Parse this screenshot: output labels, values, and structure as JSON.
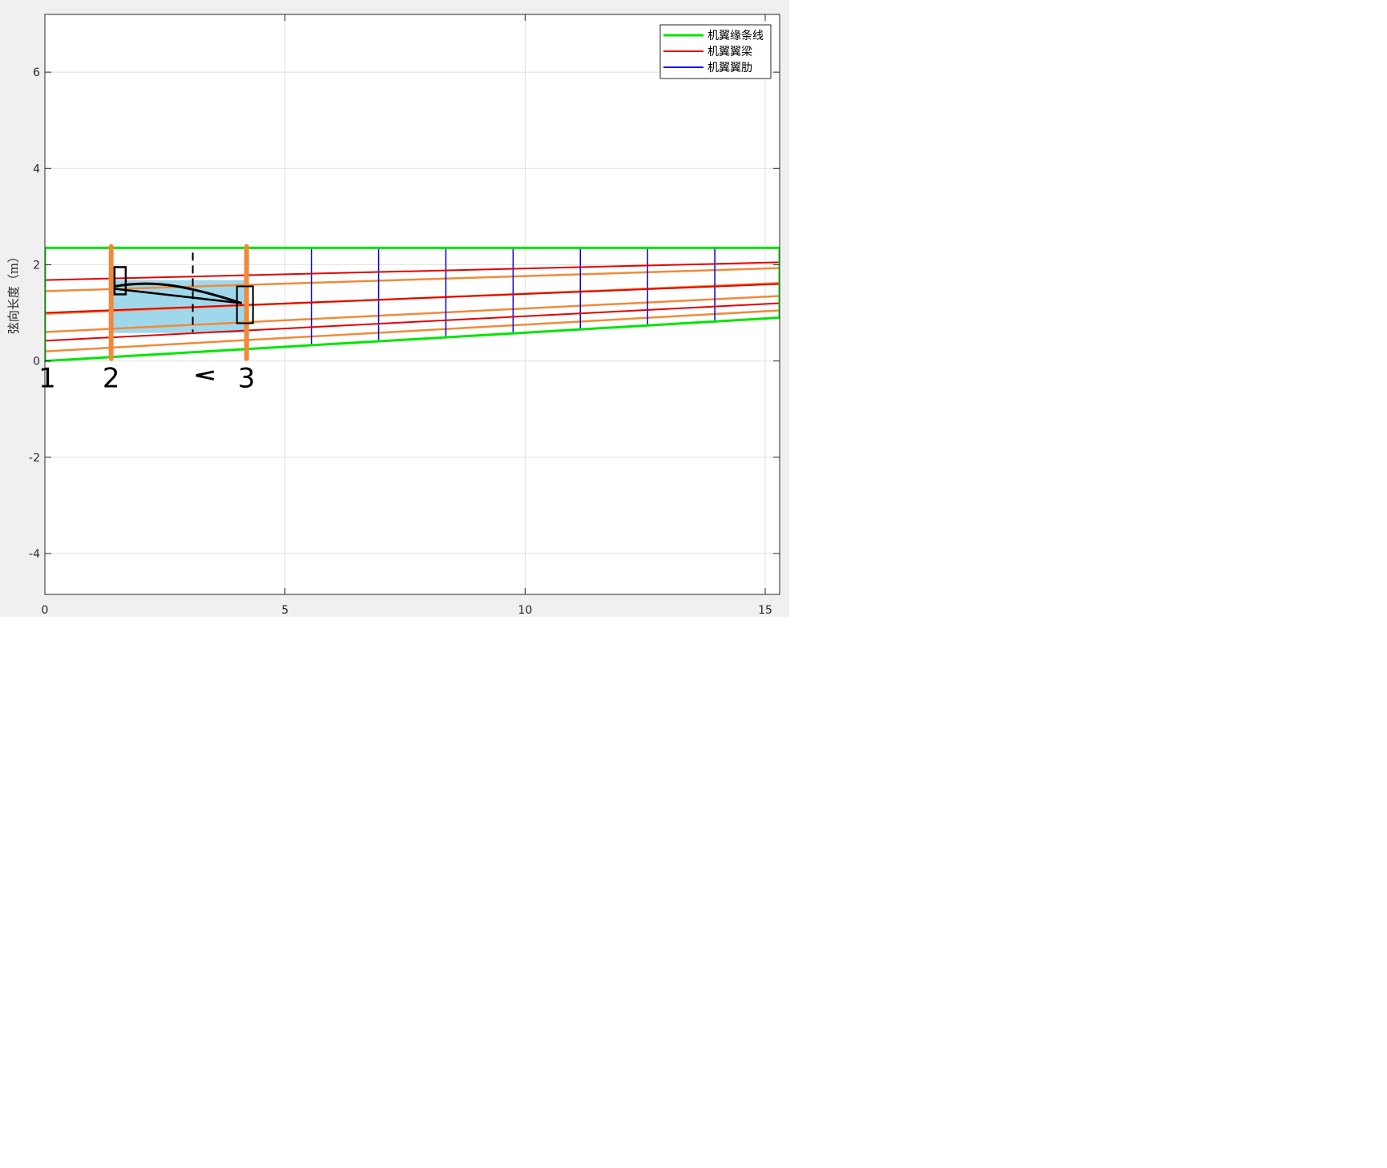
{
  "chart_data": {
    "type": "line",
    "title": "",
    "xlabel": "",
    "ylabel": "弦向长度（m）",
    "xlim": [
      0,
      15.3
    ],
    "ylim": [
      -4.85,
      7.2
    ],
    "xticks": [
      0,
      5,
      10,
      15
    ],
    "yticks": [
      -4,
      -2,
      0,
      2,
      4,
      6
    ],
    "grid": true,
    "legend_position": "top-right",
    "legend": [
      {
        "label": "机翼缘条线",
        "color": "#00e600"
      },
      {
        "label": "机翼翼梁",
        "color": "#e60000"
      },
      {
        "label": "机翼翼肋",
        "color": "#0000e6"
      }
    ],
    "outline": {
      "x": [
        0,
        0,
        15.3,
        15.3,
        0
      ],
      "y": [
        0,
        2.35,
        2.35,
        0.9,
        0
      ]
    },
    "spars": [
      {
        "x": [
          0,
          15.3
        ],
        "y": [
          0.42,
          1.2
        ]
      },
      {
        "x": [
          0,
          15.3
        ],
        "y": [
          1.0,
          1.6
        ]
      },
      {
        "x": [
          0,
          15.3
        ],
        "y": [
          1.68,
          2.05
        ]
      }
    ],
    "ribs": [
      {
        "x": 5.55,
        "y": [
          0.32,
          2.35
        ]
      },
      {
        "x": 6.95,
        "y": [
          0.4,
          2.35
        ]
      },
      {
        "x": 8.35,
        "y": [
          0.5,
          2.35
        ]
      },
      {
        "x": 9.75,
        "y": [
          0.57,
          2.35
        ]
      },
      {
        "x": 11.15,
        "y": [
          0.65,
          2.35
        ]
      },
      {
        "x": 12.55,
        "y": [
          0.75,
          2.35
        ]
      },
      {
        "x": 13.95,
        "y": [
          0.83,
          2.35
        ]
      }
    ],
    "annotations": {
      "orange_chord_lines": [
        {
          "x": [
            0,
            15.3
          ],
          "y": [
            0.2,
            1.05
          ]
        },
        {
          "x": [
            0,
            15.3
          ],
          "y": [
            0.6,
            1.35
          ]
        },
        {
          "x": [
            0,
            15.3
          ],
          "y": [
            0.98,
            1.62
          ]
        },
        {
          "x": [
            0,
            15.3
          ],
          "y": [
            1.45,
            1.93
          ]
        }
      ],
      "orange_stations": [
        1.38,
        4.2
      ],
      "dashed_station": 3.08,
      "shaded_region": {
        "x": [
          1.38,
          4.2
        ],
        "y": [
          0.58,
          1.68
        ]
      },
      "handwritten_labels": [
        "1",
        "2",
        "3"
      ]
    }
  }
}
